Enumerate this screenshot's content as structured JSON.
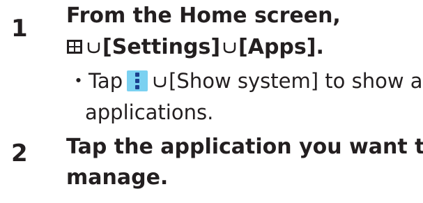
{
  "steps": [
    {
      "number": "1",
      "line1": "From the Home screen,",
      "settings": "[Settings]",
      "apps": "[Apps].",
      "note_bullet": "・",
      "note_tap": "Tap",
      "note_action": "[Show system] to show all",
      "note_cont": "applications."
    },
    {
      "number": "2",
      "line1": "Tap the application you want to",
      "line2": "manage."
    }
  ],
  "icons": [
    "apps-grid-icon",
    "flow-arrow-icon",
    "menu-dots-icon"
  ]
}
